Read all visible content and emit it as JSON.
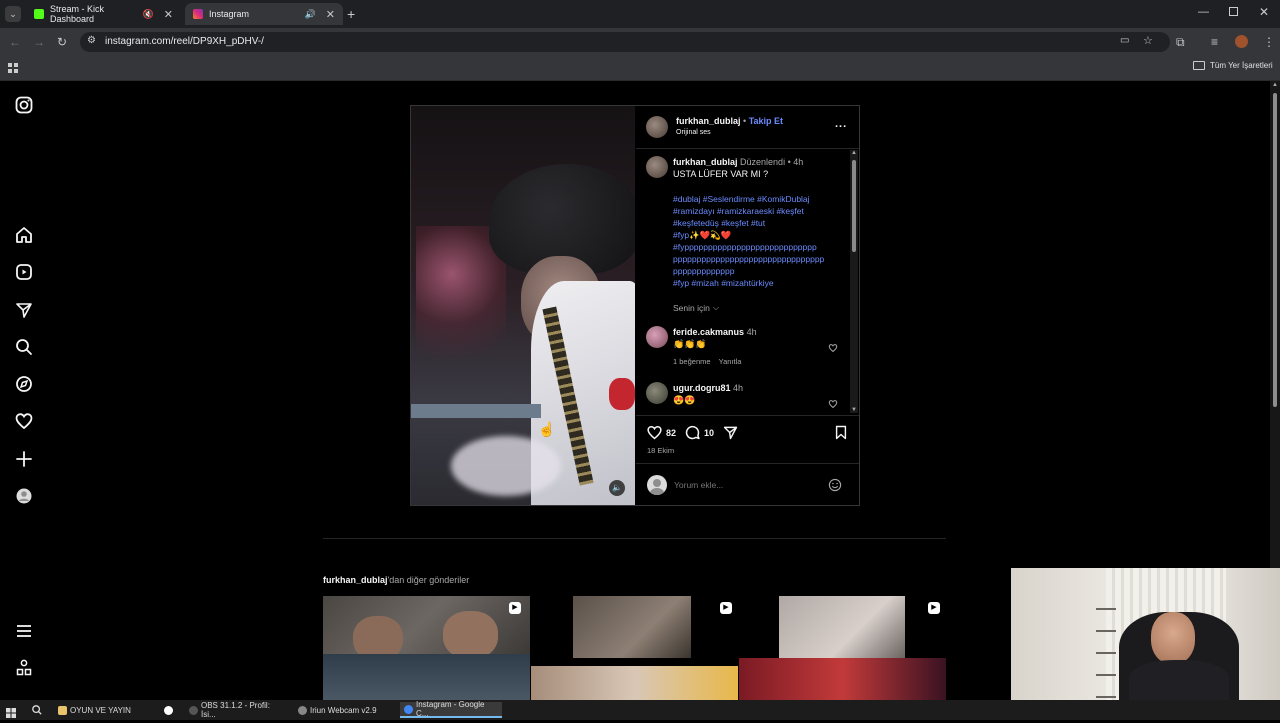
{
  "browser": {
    "tabs": [
      {
        "label": "Stream - Kick Dashboard",
        "favicon_color": "#53fc18",
        "active": false
      },
      {
        "label": "Instagram",
        "favicon_color": "#e1306c",
        "active": true
      }
    ],
    "url": "instagram.com/reel/DP9XH_pDHV-/",
    "bookmarks_label": "Tüm Yer İşaretleri"
  },
  "sidebar": {
    "icons": [
      "instagram-logo-icon",
      "home-icon",
      "reels-icon",
      "messages-icon",
      "search-icon",
      "explore-icon",
      "notifications-icon",
      "create-icon",
      "profile-icon",
      "menu-icon",
      "more-apps-icon"
    ]
  },
  "post": {
    "header": {
      "username": "furkhan_dublaj",
      "separator": "•",
      "follow": "Takip Et",
      "audio": "Orijinal ses",
      "more": "..."
    },
    "caption": {
      "username": "furkhan_dublaj",
      "edited": "Düzenlendi",
      "separator": "•",
      "time": "4h",
      "text": "USTA LÜFER VAR MI ?",
      "hashtags": [
        "#dublaj #Seslendirme #KomikDublaj",
        "#ramizdayı #ramizkaraeski #keşfet",
        "#keşfetedüş #keşfet #tut",
        "#fyp✨❤️💫❤️",
        "#fypppppppppppppppppppppppppppp",
        "pppppppppppppppppppppppppppppppp",
        "ppppppppppppp",
        "#fyp #mizah #mizahtürkiye"
      ],
      "for_you": "Senin için"
    },
    "comments": [
      {
        "username": "feride.cakmanus",
        "time": "4h",
        "text": "👏👏👏",
        "likes": "1 beğenme",
        "reply": "Yanıtla"
      },
      {
        "username": "ugur.dogru81",
        "time": "4h",
        "text": "😍😍",
        "likes": "",
        "reply": ""
      }
    ],
    "actions": {
      "like_count": "82",
      "comment_count": "10",
      "date": "18 Ekim"
    },
    "comment_input": {
      "placeholder": "Yorum ekle..."
    }
  },
  "more_posts": {
    "username": "furkhan_dublaj",
    "suffix": "'dan diğer gönderiler"
  },
  "taskbar": {
    "items": [
      {
        "label": "OYUN VE YAYIN",
        "color": "#e9c46a"
      },
      {
        "label": "OBS 31.1.2 - Profil: İsi...",
        "color": "#555555"
      },
      {
        "label": "Iriun Webcam v2.9",
        "color": "#888888"
      },
      {
        "label": "Instagram - Google C...",
        "color": "#4285f4"
      }
    ]
  }
}
